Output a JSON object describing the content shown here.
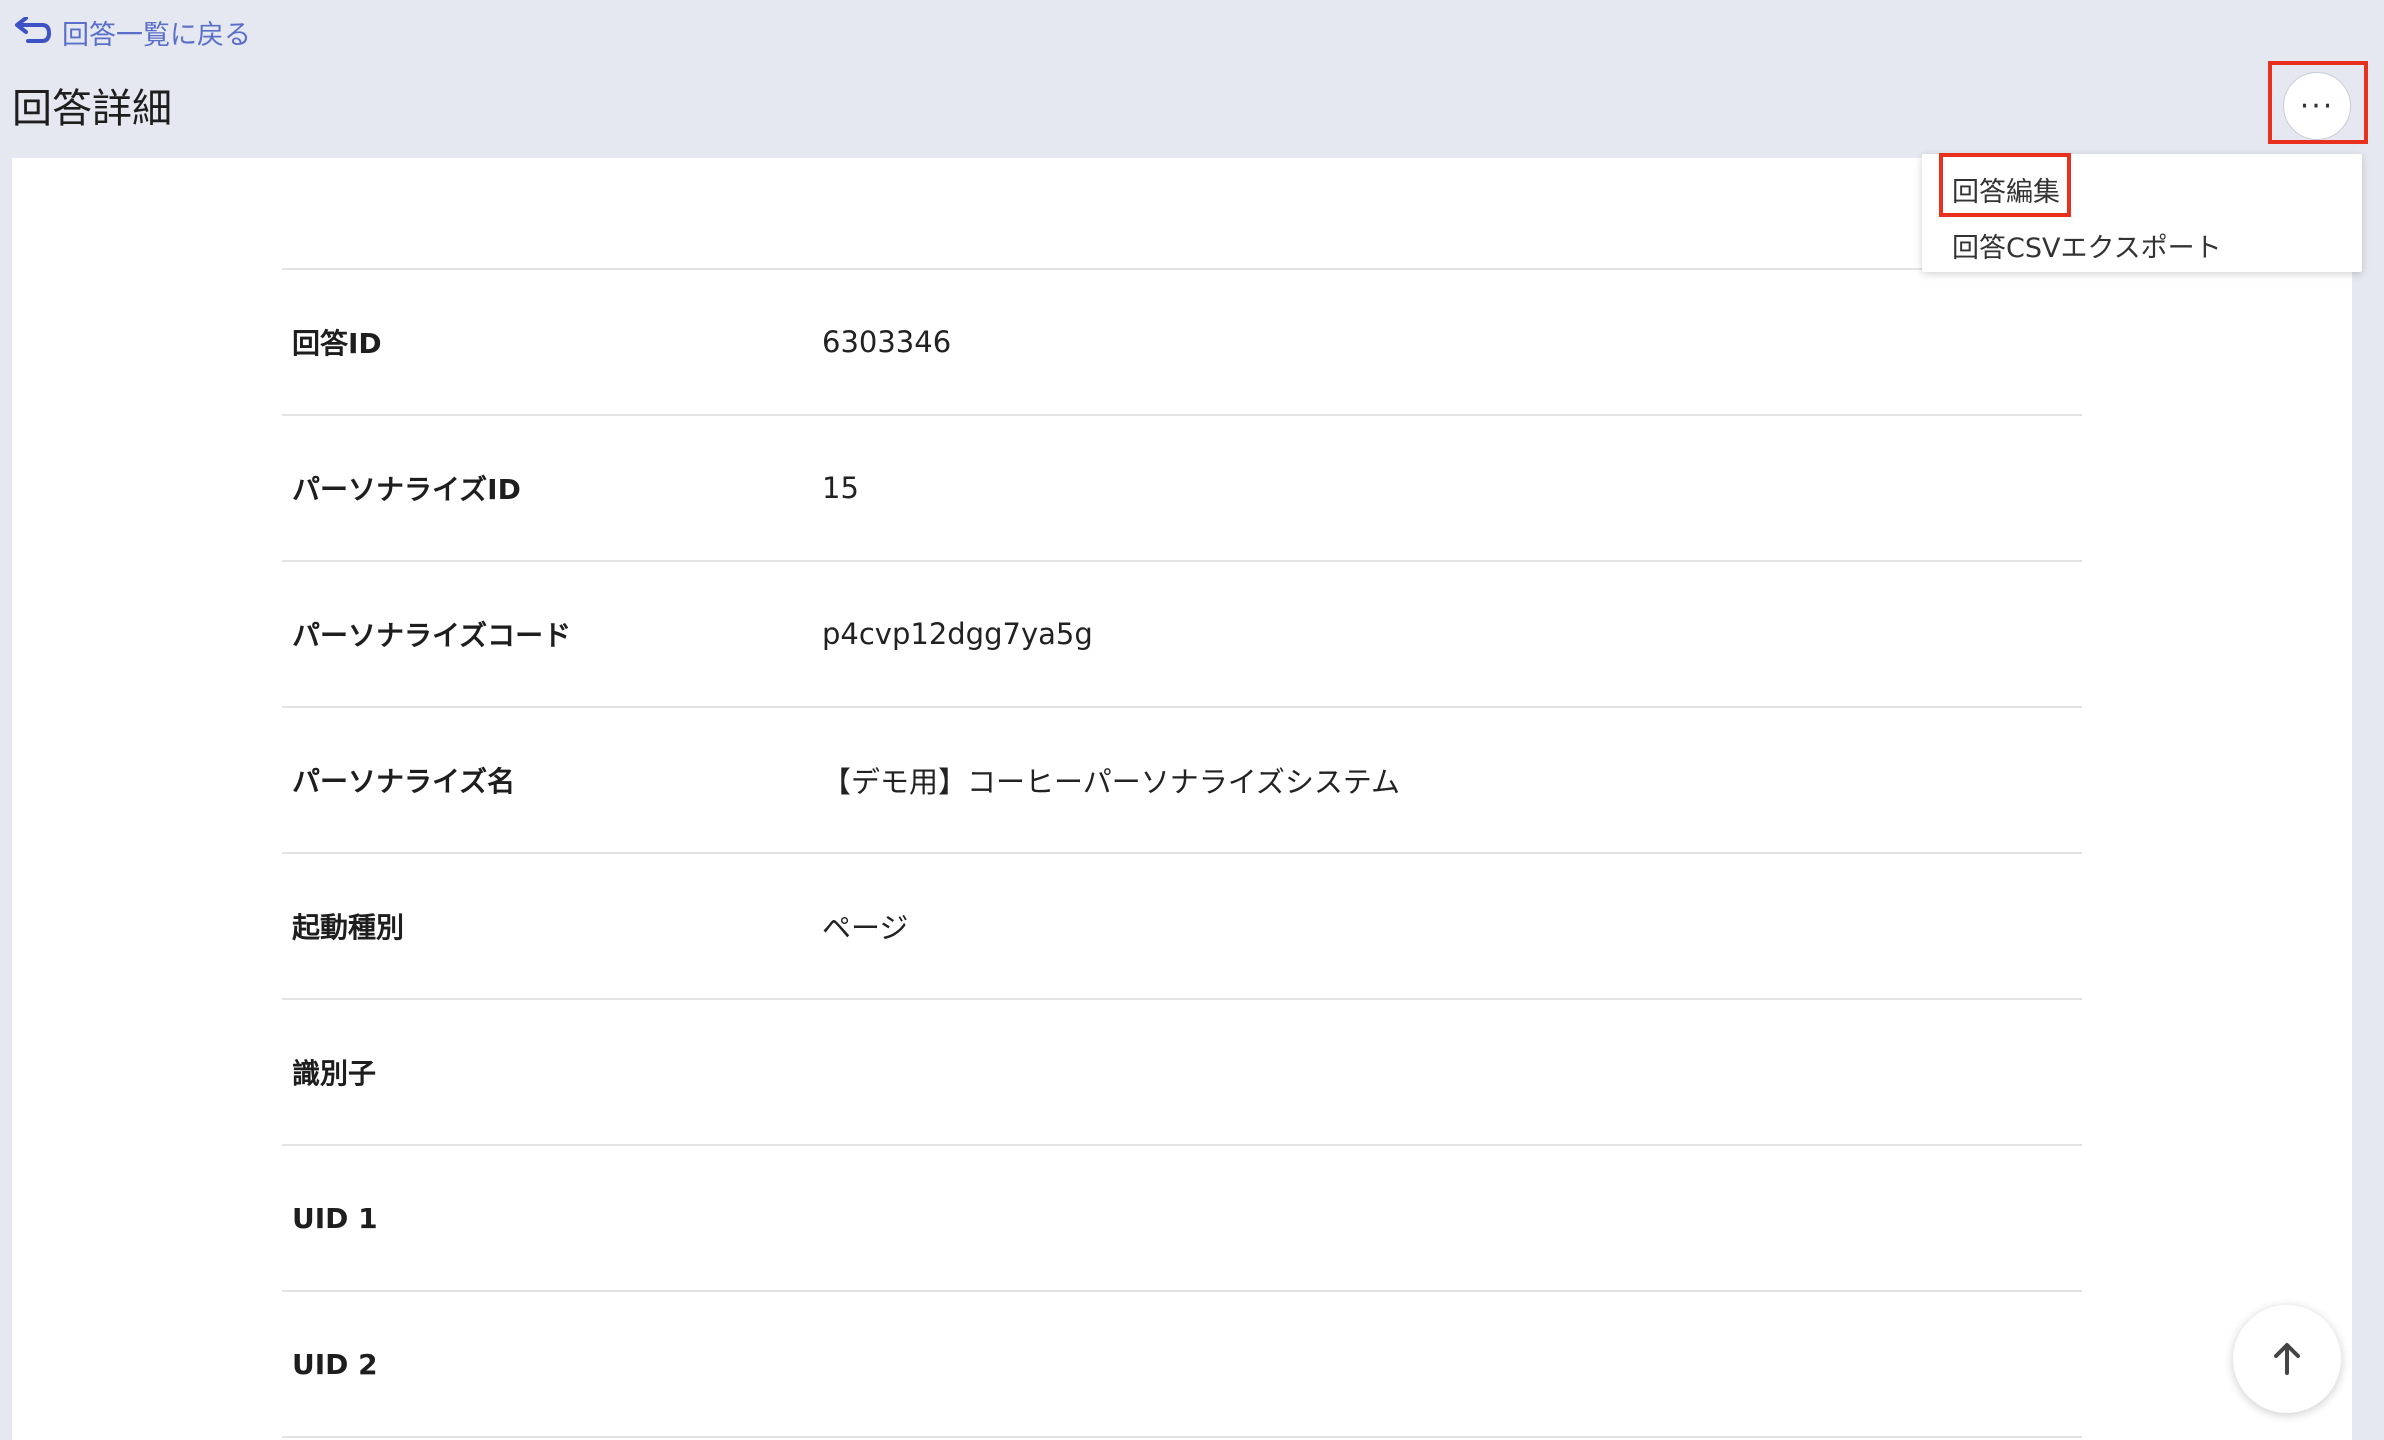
{
  "header": {
    "back_link_label": "回答一覧に戻る",
    "page_title": "回答詳細",
    "more_button_label": "···"
  },
  "menu": {
    "items": [
      {
        "label": "回答編集"
      },
      {
        "label": "回答CSVエクスポート"
      }
    ]
  },
  "details": {
    "rows": [
      {
        "label": "回答ID",
        "value": "6303346"
      },
      {
        "label": "パーソナライズID",
        "value": "15"
      },
      {
        "label": "パーソナライズコード",
        "value": "p4cvp12dgg7ya5g"
      },
      {
        "label": "パーソナライズ名",
        "value": "【デモ用】コーヒーパーソナライズシステム"
      },
      {
        "label": "起動種別",
        "value": "ページ"
      },
      {
        "label": "識別子",
        "value": ""
      },
      {
        "label": "UID 1",
        "value": ""
      },
      {
        "label": "UID 2",
        "value": ""
      }
    ]
  },
  "colors": {
    "background": "#e5e8f0",
    "link": "#5a6fc9",
    "highlight": "#e8301e",
    "card": "#ffffff"
  },
  "icons": {
    "back": "undo-arrow-icon",
    "scroll_top": "arrow-up-icon"
  }
}
